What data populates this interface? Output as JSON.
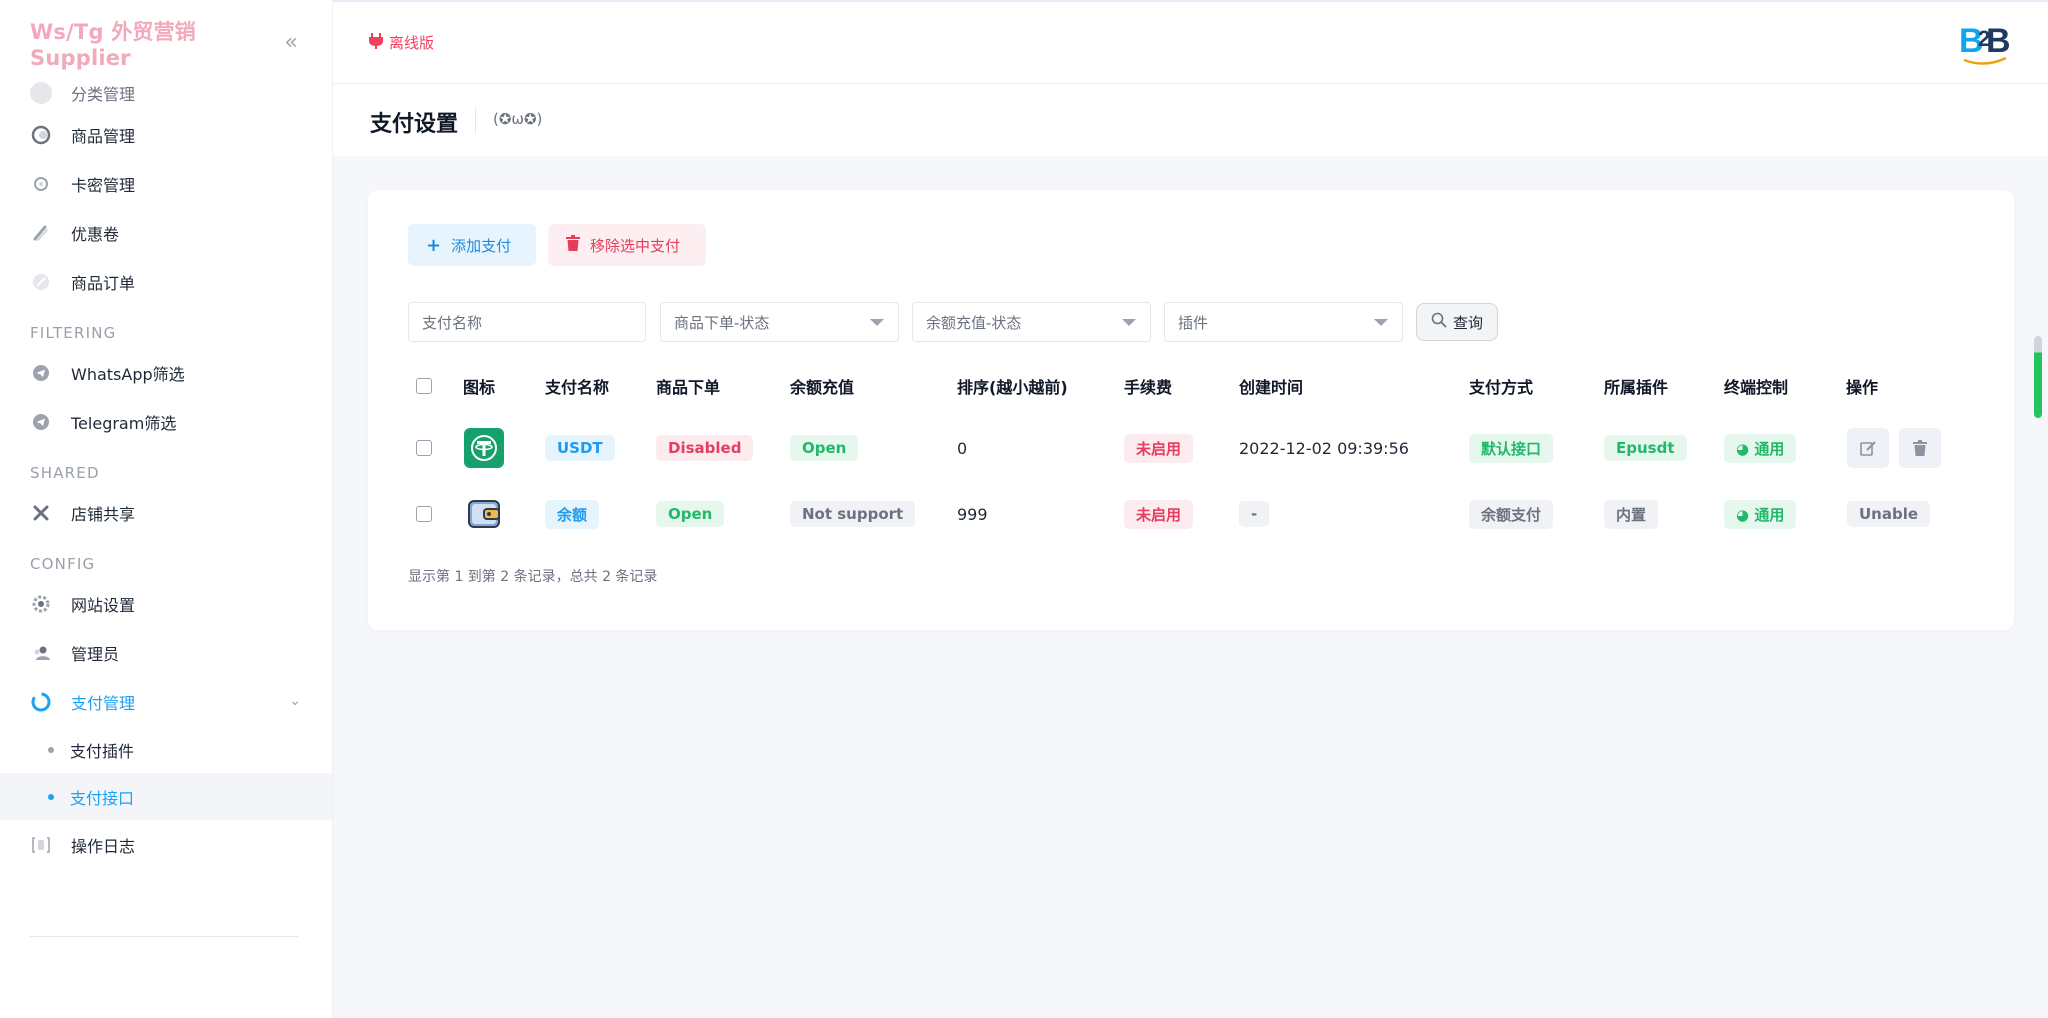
{
  "app": {
    "brand_title": "Ws/Tg 外贸营销 Supplier",
    "offline_label": "离线版",
    "logo_text": "BZB"
  },
  "sidebar": {
    "items_top": [
      {
        "label": "分类管理",
        "icon": "category-icon"
      },
      {
        "label": "商品管理",
        "icon": "goods-icon"
      },
      {
        "label": "卡密管理",
        "icon": "card-key-icon"
      },
      {
        "label": "优惠卷",
        "icon": "coupon-icon"
      },
      {
        "label": "商品订单",
        "icon": "order-icon"
      }
    ],
    "sections": {
      "filtering": "FILTERING",
      "shared": "SHARED",
      "config": "CONFIG"
    },
    "filtering_items": [
      {
        "label": "WhatsApp筛选",
        "icon": "telegram-icon"
      },
      {
        "label": "Telegram筛选",
        "icon": "telegram-icon"
      }
    ],
    "shared_items": [
      {
        "label": "店铺共享",
        "icon": "share-icon"
      }
    ],
    "config_items": [
      {
        "label": "网站设置",
        "icon": "gear-icon"
      },
      {
        "label": "管理员",
        "icon": "admin-icon"
      },
      {
        "label": "支付管理",
        "icon": "payment-icon"
      }
    ],
    "payment_sub": [
      {
        "label": "支付插件"
      },
      {
        "label": "支付接口"
      }
    ],
    "log_item": {
      "label": "操作日志",
      "icon": "log-icon"
    }
  },
  "page": {
    "title": "支付设置",
    "emote": "(✪ω✪)"
  },
  "toolbar": {
    "add_label": "添加支付",
    "remove_label": "移除选中支付"
  },
  "filters": {
    "name_placeholder": "支付名称",
    "order_status": "商品下单-状态",
    "balance_status": "余额充值-状态",
    "plugin": "插件",
    "query_label": "查询"
  },
  "table": {
    "headers": [
      "图标",
      "支付名称",
      "商品下单",
      "余额充值",
      "排序(越小越前)",
      "手续费",
      "创建时间",
      "支付方式",
      "所属插件",
      "终端控制",
      "操作"
    ],
    "rows": [
      {
        "name": "USDT",
        "order": "Disabled",
        "balance": "Open",
        "sort": "0",
        "fee": "未启用",
        "created": "2022-12-02 09:39:56",
        "method": "默认接口",
        "plugin": "Epusdt",
        "terminal": "通用",
        "icon": "usdt-icon"
      },
      {
        "name": "余额",
        "order": "Open",
        "balance": "Not support",
        "sort": "999",
        "fee": "未启用",
        "created": "-",
        "method": "余额支付",
        "plugin": "内置",
        "terminal": "通用",
        "action": "Unable",
        "icon": "wallet-icon"
      }
    ],
    "footer": "显示第 1 到第 2 条记录，总共 2 条记录"
  },
  "colors": {
    "brand": "#f2a9bb",
    "accent": "#1da1f2",
    "danger": "#e63d5f",
    "success": "#22b86a"
  }
}
